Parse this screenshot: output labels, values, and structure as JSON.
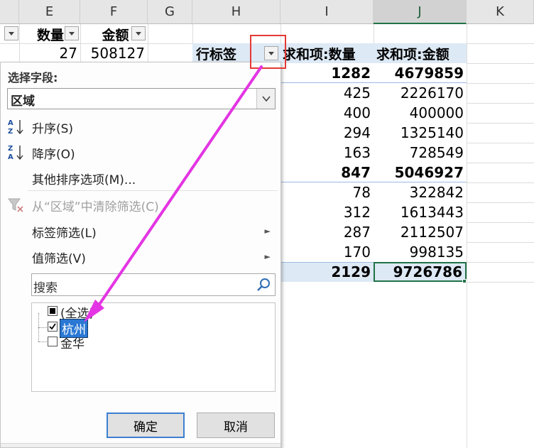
{
  "columns": [
    "E",
    "F",
    "G",
    "H",
    "I",
    "J",
    "K"
  ],
  "source_table": {
    "headers": [
      "数量",
      "金额"
    ],
    "row1": [
      "27",
      "508127"
    ]
  },
  "pivot": {
    "row_label_header": "行标签",
    "col1_header": "求和项:数量",
    "col2_header": "求和项:金额",
    "rows": [
      {
        "qty": "1282",
        "amt": "4679859",
        "bold": true
      },
      {
        "qty": "425",
        "amt": "2226170",
        "bold": false
      },
      {
        "qty": "400",
        "amt": "400000",
        "bold": false
      },
      {
        "qty": "294",
        "amt": "1325140",
        "bold": false
      },
      {
        "qty": "163",
        "amt": "728549",
        "bold": false
      },
      {
        "qty": "847",
        "amt": "5046927",
        "bold": true
      },
      {
        "qty": "78",
        "amt": "322842",
        "bold": false
      },
      {
        "qty": "312",
        "amt": "1613443",
        "bold": false
      },
      {
        "qty": "287",
        "amt": "2112507",
        "bold": false
      },
      {
        "qty": "170",
        "amt": "998135",
        "bold": false
      }
    ],
    "total": {
      "qty": "2129",
      "amt": "9726786"
    }
  },
  "filter_popup": {
    "select_field_label": "选择字段:",
    "field_value": "区域",
    "menu": {
      "sort_asc": "升序(S)",
      "sort_desc": "降序(O)",
      "more_sort": "其他排序选项(M)...",
      "clear_filter": "从“区域”中清除筛选(C)",
      "label_filter": "标签筛选(L)",
      "value_filter": "值筛选(V)"
    },
    "search_placeholder": "搜索",
    "items": [
      {
        "label": "(全选)",
        "state": "partial"
      },
      {
        "label": "杭州",
        "state": "checked"
      },
      {
        "label": "金华",
        "state": "unchecked"
      }
    ],
    "ok_label": "确定",
    "cancel_label": "取消"
  },
  "annotation_colors": {
    "highlight_box": "#e53935",
    "arrow": "#e335e3",
    "selection": "#217346",
    "pivot_header_fill": "#dde9f5"
  }
}
